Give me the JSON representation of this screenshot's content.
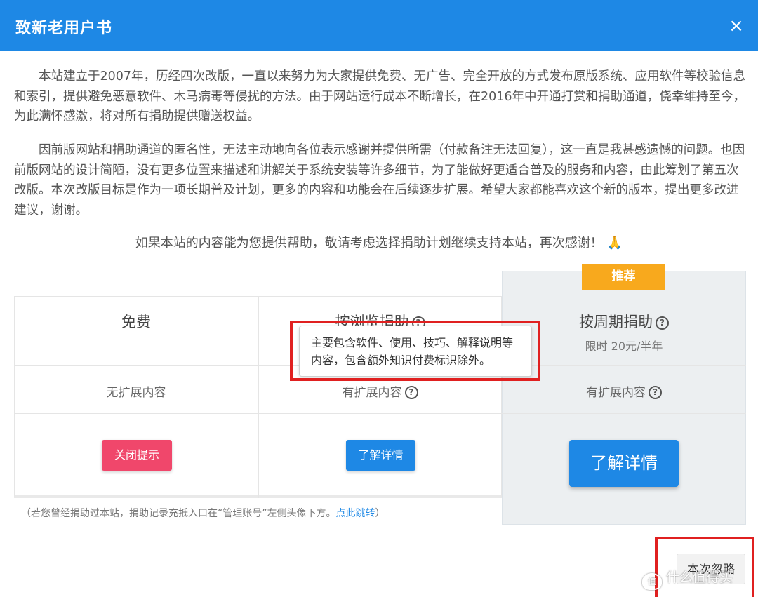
{
  "dialog": {
    "title": "致新老用户书",
    "close_icon": "×"
  },
  "intro": {
    "paragraph_1": "本站建立于2007年，历经四次改版，一直以来努力为大家提供免费、无广告、完全开放的方式发布原版系统、应用软件等校验信息和索引，提供避免恶意软件、木马病毒等侵扰的方法。由于网站运行成本不断增长，在2016年中开通打赏和捐助通道，侥幸维持至今，为此满怀感激，将对所有捐助提供赠送权益。",
    "paragraph_2": "因前版网站和捐助通道的匿名性，无法主动地向各位表示感谢并提供所需（付款备注无法回复），这一直是我甚感遗憾的问题。也因前版网站的设计简陋，没有更多位置来描述和讲解关于系统安装等许多细节，为了能做好更适合普及的服务和内容，由此筹划了第五次改版。本次改版目标是作为一项长期普及计划，更多的内容和功能会在后续逐步扩展。希望大家都能喜欢这个新的版本，提出更多改进建议，谢谢。",
    "thanks_line": "如果本站的内容能为您提供帮助，敬请考虑选择捐助计划继续支持本站，再次感谢！",
    "thanks_emoji": "🙏"
  },
  "plans": [
    {
      "name": "免费",
      "ext": "无扩展内容",
      "button": "关闭提示"
    },
    {
      "name": "按浏览捐助",
      "ext": "有扩展内容",
      "button": "了解详情"
    },
    {
      "name": "按周期捐助",
      "sub": "限时 20元/半年",
      "ext": "有扩展内容",
      "button": "了解详情",
      "badge": "推荐"
    }
  ],
  "help_icon": "?",
  "tooltip": {
    "text": "主要包含软件、使用、技巧、解释说明等内容，包含额外知识付费标识除外。"
  },
  "footnote": {
    "text": "（若您曾经捐助过本站，捐助记录充抵入口在“管理账号”左侧头像下方。",
    "link": "点此跳转",
    "end": "）"
  },
  "footer": {
    "ignore_button": "本次忽略"
  },
  "watermark": {
    "logo": "值",
    "text": "什么值得买"
  },
  "colors": {
    "header": "#1e88e5",
    "primary_button": "#1e88e5",
    "danger_button": "#f0476b",
    "badge": "#f8a91d",
    "highlight_box": "#e02020"
  }
}
